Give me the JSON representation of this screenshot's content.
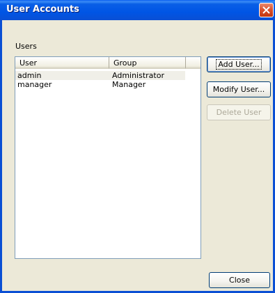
{
  "window": {
    "title": "User Accounts"
  },
  "users_group_label": "Users",
  "table": {
    "headers": [
      "User",
      "Group",
      ""
    ],
    "rows": [
      {
        "user": "admin",
        "group": "Administrator",
        "selected": true
      },
      {
        "user": "manager",
        "group": "Manager",
        "selected": false
      }
    ]
  },
  "buttons": {
    "add_user": "Add User...",
    "modify_user": "Modify User...",
    "delete_user": "Delete User",
    "close": "Close"
  },
  "colors": {
    "titlebar": "#0055e5",
    "close_button": "#d9502d",
    "dialog_bg": "#ece9d8"
  }
}
